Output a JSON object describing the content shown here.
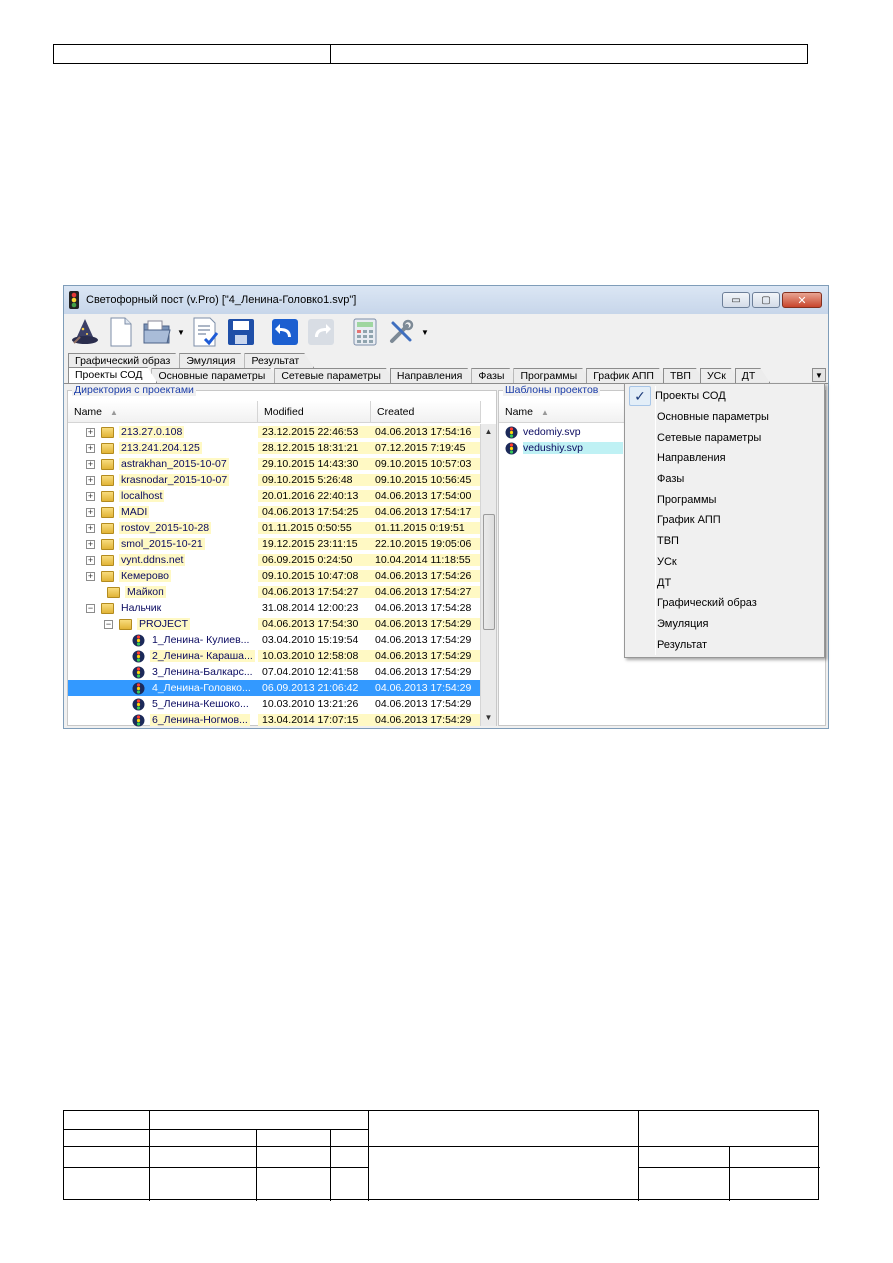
{
  "window": {
    "title": "Светофорный пост (v.Pro) [\"4_Ленина-Головко1.svp\"]",
    "controls": {
      "minimize": "▭",
      "maximize": "▢",
      "close": "✕"
    }
  },
  "toolbar": {
    "icons": [
      "wizard-icon",
      "new-file-icon",
      "open-folder-icon",
      "checklist-icon",
      "save-icon",
      "undo-icon",
      "redo-icon",
      "calculator-icon",
      "tools-icon"
    ]
  },
  "tabs_row1": [
    "Графический образ",
    "Эмуляция",
    "Результат"
  ],
  "tabs_row2": [
    "Проекты СОД",
    "Основные параметры",
    "Сетевые параметры",
    "Направления",
    "Фазы",
    "Программы",
    "График АПП",
    "ТВП",
    "УСк",
    "ДТ"
  ],
  "left_panel": {
    "label": "Директория с проектами",
    "columns": [
      "Name",
      "Modified",
      "Created"
    ],
    "rows": [
      {
        "name": "213.27.0.108",
        "modified": "23.12.2015 22:46:53",
        "created": "04.06.2013 17:54:16"
      },
      {
        "name": "213.241.204.125",
        "modified": "28.12.2015 18:31:21",
        "created": "07.12.2015 7:19:45"
      },
      {
        "name": "astrakhan_2015-10-07",
        "modified": "29.10.2015 14:43:30",
        "created": "09.10.2015 10:57:03"
      },
      {
        "name": "krasnodar_2015-10-07",
        "modified": "09.10.2015 5:26:48",
        "created": "09.10.2015 10:56:45"
      },
      {
        "name": "localhost",
        "modified": "20.01.2016 22:40:13",
        "created": "04.06.2013 17:54:00"
      },
      {
        "name": "MADI",
        "modified": "04.06.2013 17:54:25",
        "created": "04.06.2013 17:54:17"
      },
      {
        "name": "rostov_2015-10-28",
        "modified": "01.11.2015 0:50:55",
        "created": "01.11.2015 0:19:51"
      },
      {
        "name": "smol_2015-10-21",
        "modified": "19.12.2015 23:11:15",
        "created": "22.10.2015 19:05:06"
      },
      {
        "name": "vynt.ddns.net",
        "modified": "06.09.2015 0:24:50",
        "created": "10.04.2014 11:18:55"
      },
      {
        "name": "Кемерово",
        "modified": "09.10.2015 10:47:08",
        "created": "04.06.2013 17:54:26"
      },
      {
        "name": "Майкоп",
        "modified": "04.06.2013 17:54:27",
        "created": "04.06.2013 17:54:27"
      },
      {
        "name": "Нальчик",
        "modified": "31.08.2014 12:00:23",
        "created": "04.06.2013 17:54:28"
      },
      {
        "name": "PROJECT",
        "modified": "04.06.2013 17:54:30",
        "created": "04.06.2013 17:54:29"
      },
      {
        "name": "1_Ленина- Кулиев...",
        "modified": "03.04.2010 15:19:54",
        "created": "04.06.2013 17:54:29"
      },
      {
        "name": "2_Ленина- Караша...",
        "modified": "10.03.2010 12:58:08",
        "created": "04.06.2013 17:54:29"
      },
      {
        "name": "3_Ленина-Балкарс...",
        "modified": "07.04.2010 12:41:58",
        "created": "04.06.2013 17:54:29"
      },
      {
        "name": "4_Ленина-Головко...",
        "modified": "06.09.2013 21:06:42",
        "created": "04.06.2013 17:54:29"
      },
      {
        "name": "5_Ленина-Кешоко...",
        "modified": "10.03.2010 13:21:26",
        "created": "04.06.2013 17:54:29"
      },
      {
        "name": "6_Ленина-Ногмов...",
        "modified": "13.04.2014 17:07:15",
        "created": "04.06.2013 17:54:29"
      }
    ]
  },
  "right_panel": {
    "label": "Шаблоны проектов",
    "columns": [
      "Name"
    ],
    "rows": [
      "vedomiy.svp",
      "vedushiy.svp"
    ]
  },
  "context_menu": {
    "checked_index": 0,
    "check_mark": "✓",
    "items": [
      "Проекты СОД",
      "Основные параметры",
      "Сетевые параметры",
      "Направления",
      "Фазы",
      "Программы",
      "График АПП",
      "ТВП",
      "УСк",
      "ДТ",
      "Графический образ",
      "Эмуляция",
      "Результат"
    ]
  },
  "colors": {
    "highlight_row": "#fff9c4",
    "selection": "#3399ff",
    "template_selection": "#bff1f4",
    "group_label": "#1a3ca8"
  }
}
